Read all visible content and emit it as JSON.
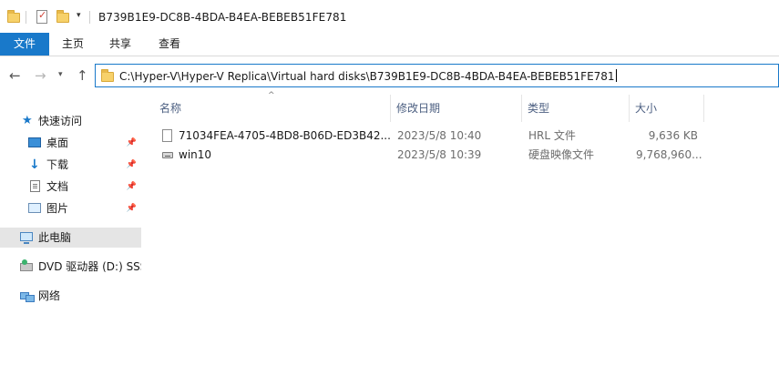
{
  "window": {
    "title": "B739B1E9-DC8B-4BDA-B4EA-BEBEB51FE781",
    "quick_access_icons": [
      "folder-icon",
      "properties-icon",
      "new-folder-icon"
    ],
    "quick_access_dropdown": "▾"
  },
  "ribbon": {
    "tabs": [
      {
        "label": "文件",
        "active": true
      },
      {
        "label": "主页",
        "active": false
      },
      {
        "label": "共享",
        "active": false
      },
      {
        "label": "查看",
        "active": false
      }
    ],
    "accent_color": "#1979ca"
  },
  "nav": {
    "back": "←",
    "forward": "→",
    "recent": "▾",
    "up": "↑"
  },
  "address": {
    "path": "C:\\Hyper-V\\Hyper-V Replica\\Virtual hard disks\\B739B1E9-DC8B-4BDA-B4EA-BEBEB51FE781"
  },
  "sidebar": {
    "items": [
      {
        "label": "快速访问",
        "icon": "star-icon",
        "pinned": false
      },
      {
        "label": "桌面",
        "icon": "desktop-icon",
        "pinned": true
      },
      {
        "label": "下载",
        "icon": "download-icon",
        "pinned": true
      },
      {
        "label": "文档",
        "icon": "documents-icon",
        "pinned": true
      },
      {
        "label": "图片",
        "icon": "pictures-icon",
        "pinned": true
      },
      {
        "label": "此电脑",
        "icon": "this-pc-icon",
        "pinned": false,
        "selected": true
      },
      {
        "label": "DVD 驱动器 (D:) SSS",
        "icon": "dvd-drive-icon",
        "pinned": false
      },
      {
        "label": "网络",
        "icon": "network-icon",
        "pinned": false
      }
    ],
    "pin_glyph": "📌"
  },
  "columns": {
    "name": "名称",
    "modified": "修改日期",
    "type": "类型",
    "size": "大小",
    "sort_glyph": "^"
  },
  "files": [
    {
      "name": "71034FEA-4705-4BD8-B06D-ED3B42...",
      "modified": "2023/5/8 10:40",
      "type": "HRL 文件",
      "size": "9,636 KB",
      "icon": "file-icon"
    },
    {
      "name": "win10",
      "modified": "2023/5/8 10:39",
      "type": "硬盘映像文件",
      "size": "9,768,960...",
      "icon": "disk-image-icon"
    }
  ]
}
